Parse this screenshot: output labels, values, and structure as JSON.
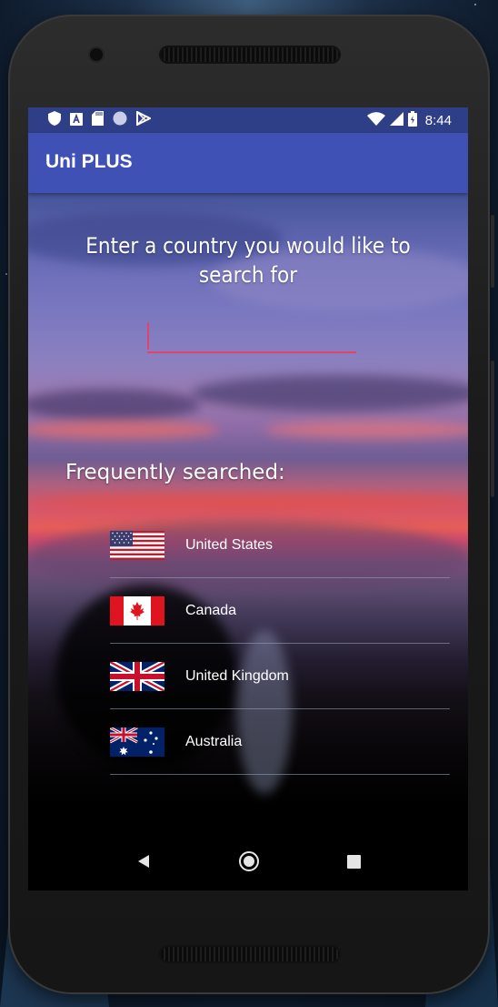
{
  "status_bar": {
    "time": "8:44",
    "icons_left": [
      "shield-icon",
      "font-a-icon",
      "sd-card-icon",
      "circle-icon",
      "play-store-icon"
    ],
    "icons_right": [
      "wifi-icon",
      "signal-icon",
      "battery-icon"
    ]
  },
  "app_bar": {
    "title": "Uni PLUS"
  },
  "main": {
    "prompt": "Enter a country you would like to search for",
    "search": {
      "value": "",
      "placeholder": ""
    },
    "frequent_title": "Frequently searched:",
    "countries": [
      {
        "label": "United States",
        "flag": "us-flag-icon"
      },
      {
        "label": "Canada",
        "flag": "canada-flag-icon"
      },
      {
        "label": "United Kingdom",
        "flag": "uk-flag-icon"
      },
      {
        "label": "Australia",
        "flag": "australia-flag-icon"
      }
    ]
  },
  "nav_bar": {
    "buttons": [
      "back-icon",
      "home-icon",
      "recents-icon"
    ]
  },
  "colors": {
    "status_bar": "#2f3f87",
    "app_bar": "#3f51b5",
    "accent": "#e0436f",
    "divider": "#96aabe"
  }
}
